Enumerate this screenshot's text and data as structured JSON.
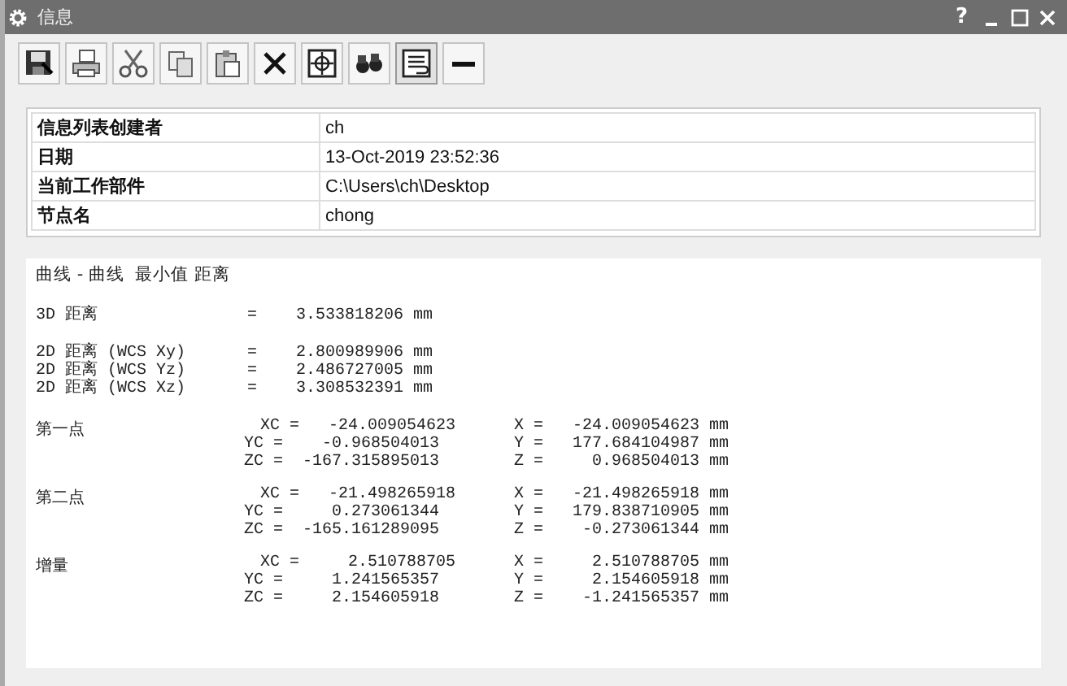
{
  "window": {
    "title": "信息",
    "help": "?"
  },
  "info_table": [
    {
      "label": "信息列表创建者",
      "value": "ch"
    },
    {
      "label": "日期",
      "value": "13-Oct-2019 23:52:36"
    },
    {
      "label": "当前工作部件",
      "value": "C:\\Users\\ch\\Desktop"
    },
    {
      "label": "节点名",
      "value": "chong"
    }
  ],
  "report": {
    "title": "曲线 - 曲线  最小值 距离",
    "distance_groups": [
      [
        {
          "label": "3D 距离",
          "eq": "=",
          "value": "3.533818206 mm"
        }
      ],
      [
        {
          "label": "2D 距离 (WCS Xy)",
          "eq": "=",
          "value": "2.800989906 mm"
        },
        {
          "label": "2D 距离 (WCS Yz)",
          "eq": "=",
          "value": "2.486727005 mm"
        },
        {
          "label": "2D 距离 (WCS Xz)",
          "eq": "=",
          "value": "3.308532391 mm"
        }
      ]
    ],
    "points": [
      {
        "label": "第一点",
        "rows": [
          {
            "local": "XC =   -24.009054623",
            "world": "X =   -24.009054623 mm"
          },
          {
            "local": "YC =    -0.968504013",
            "world": "Y =   177.684104987 mm"
          },
          {
            "local": "ZC =  -167.315895013",
            "world": "Z =     0.968504013 mm"
          }
        ]
      },
      {
        "label": "第二点",
        "rows": [
          {
            "local": "XC =   -21.498265918",
            "world": "X =   -21.498265918 mm"
          },
          {
            "local": "YC =     0.273061344",
            "world": "Y =   179.838710905 mm"
          },
          {
            "local": "ZC =  -165.161289095",
            "world": "Z =    -0.273061344 mm"
          }
        ]
      },
      {
        "label": "增量",
        "rows": [
          {
            "local": "XC =     2.510788705",
            "world": "X =     2.510788705 mm"
          },
          {
            "local": "YC =     1.241565357",
            "world": "Y =     2.154605918 mm"
          },
          {
            "local": "ZC =     2.154605918",
            "world": "Z =    -1.241565357 mm"
          }
        ]
      }
    ]
  }
}
